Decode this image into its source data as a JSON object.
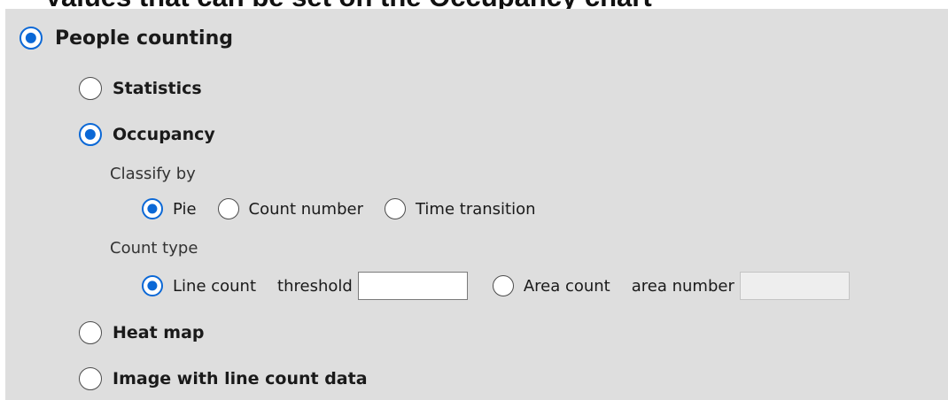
{
  "page_title": "Values that can be set on the Occupancy chart",
  "options": {
    "people_counting": "People counting",
    "statistics": "Statistics",
    "occupancy": "Occupancy",
    "heat_map": "Heat map",
    "image_line_count": "Image with line count data"
  },
  "classify_by": {
    "label": "Classify by",
    "pie": "Pie",
    "count_number": "Count number",
    "time_transition": "Time transition",
    "selected": "Pie"
  },
  "count_type": {
    "label": "Count type",
    "line_count": "Line count",
    "threshold_label": "threshold",
    "threshold_value": "",
    "area_count": "Area count",
    "area_number_label": "area number",
    "area_number_value": "",
    "selected": "Line count"
  },
  "colors": {
    "accent": "#0b68d6",
    "panel_background": "#dedede"
  }
}
